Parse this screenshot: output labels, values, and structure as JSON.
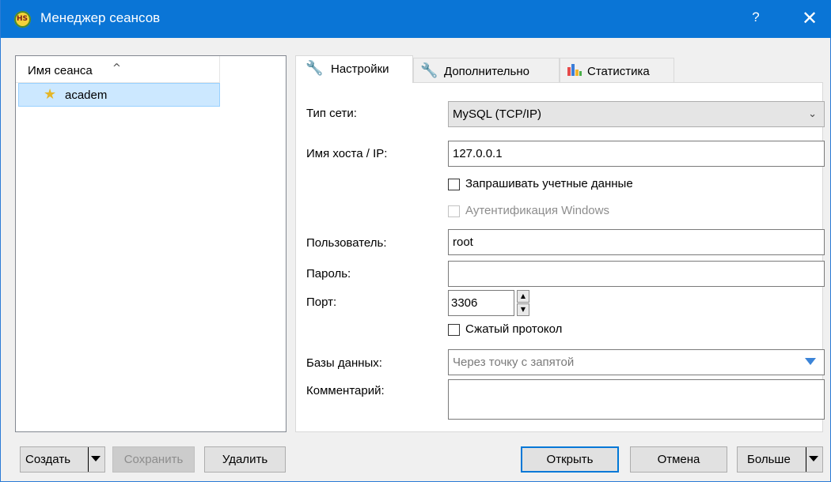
{
  "window": {
    "title": "Менеджер сеансов",
    "help": "?",
    "close": "✕"
  },
  "sessions": {
    "header": "Имя сеанса",
    "sort_indicator": "^",
    "items": [
      {
        "name": "academ",
        "selected": true
      }
    ]
  },
  "tabs": [
    {
      "label": "Настройки",
      "icon": "wrench-icon",
      "active": true
    },
    {
      "label": "Дополнительно",
      "icon": "wrench-icon",
      "active": false
    },
    {
      "label": "Статистика",
      "icon": "bar-chart-icon",
      "active": false
    }
  ],
  "settings": {
    "network_type_label": "Тип сети:",
    "network_type_value": "MySQL (TCP/IP)",
    "host_label": "Имя хоста / IP:",
    "host_value": "127.0.0.1",
    "prompt_credentials_label": "Запрашивать учетные данные",
    "windows_auth_label": "Аутентификация Windows",
    "user_label": "Пользователь:",
    "user_value": "root",
    "password_label": "Пароль:",
    "password_value": "",
    "port_label": "Порт:",
    "port_value": "3306",
    "compressed_label": "Сжатый протокол",
    "databases_label": "Базы данных:",
    "databases_placeholder": "Через точку с запятой",
    "comment_label": "Комментарий:",
    "comment_value": ""
  },
  "buttons": {
    "create": "Создать",
    "save": "Сохранить",
    "delete": "Удалить",
    "open": "Открыть",
    "cancel": "Отмена",
    "more": "Больше"
  },
  "colors": {
    "titlebar": "#0a75d6",
    "selection": "#cce8ff",
    "accent": "#0078d7"
  }
}
